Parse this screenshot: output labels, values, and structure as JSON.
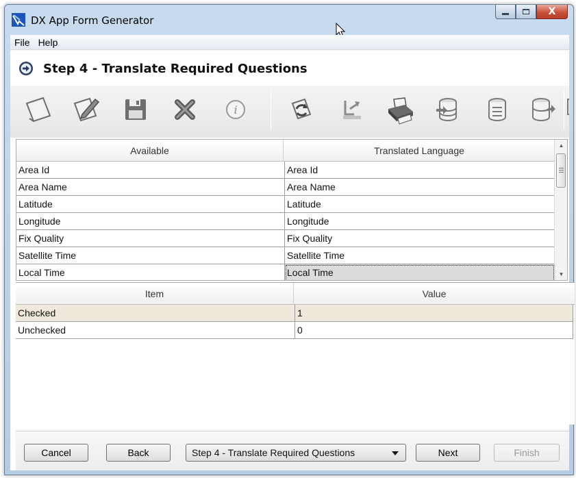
{
  "window": {
    "title": "DX App Form Generator",
    "close_glyph": "X"
  },
  "menu": [
    "File",
    "Help"
  ],
  "step": {
    "title": "Step 4 - Translate Required Questions",
    "icon": "arrow-circle-right-icon"
  },
  "toolbar": {
    "buttons": [
      "new-icon",
      "edit-icon",
      "save-icon",
      "delete-icon",
      "info-icon",
      "refresh-icon",
      "export-icon",
      "print-icon",
      "database-import-icon",
      "database-list-icon",
      "database-export-icon",
      "copy-icon"
    ]
  },
  "translate_grid": {
    "columns": [
      "Available",
      "Translated Language"
    ],
    "rows": [
      [
        "Area Id",
        "Area Id"
      ],
      [
        "Area Name",
        "Area Name"
      ],
      [
        "Latitude",
        "Latitude"
      ],
      [
        "Longitude",
        "Longitude"
      ],
      [
        "Fix Quality",
        "Fix Quality"
      ],
      [
        "Satellite Time",
        "Satellite Time"
      ],
      [
        "Local Time",
        "Local Time"
      ]
    ]
  },
  "value_grid": {
    "columns": [
      "Item",
      "Value"
    ],
    "rows": [
      [
        "Checked",
        "1"
      ],
      [
        "Unchecked",
        "0"
      ]
    ]
  },
  "footer": {
    "cancel": "Cancel",
    "back": "Back",
    "step_select": "Step 4 - Translate Required Questions",
    "next": "Next",
    "finish": "Finish"
  },
  "colors": {
    "title_gradient_top": "#c9dbee",
    "selected_row": "#efe9dc",
    "focused_cell": "#dcdcdc",
    "close_button": "#c8523c"
  }
}
